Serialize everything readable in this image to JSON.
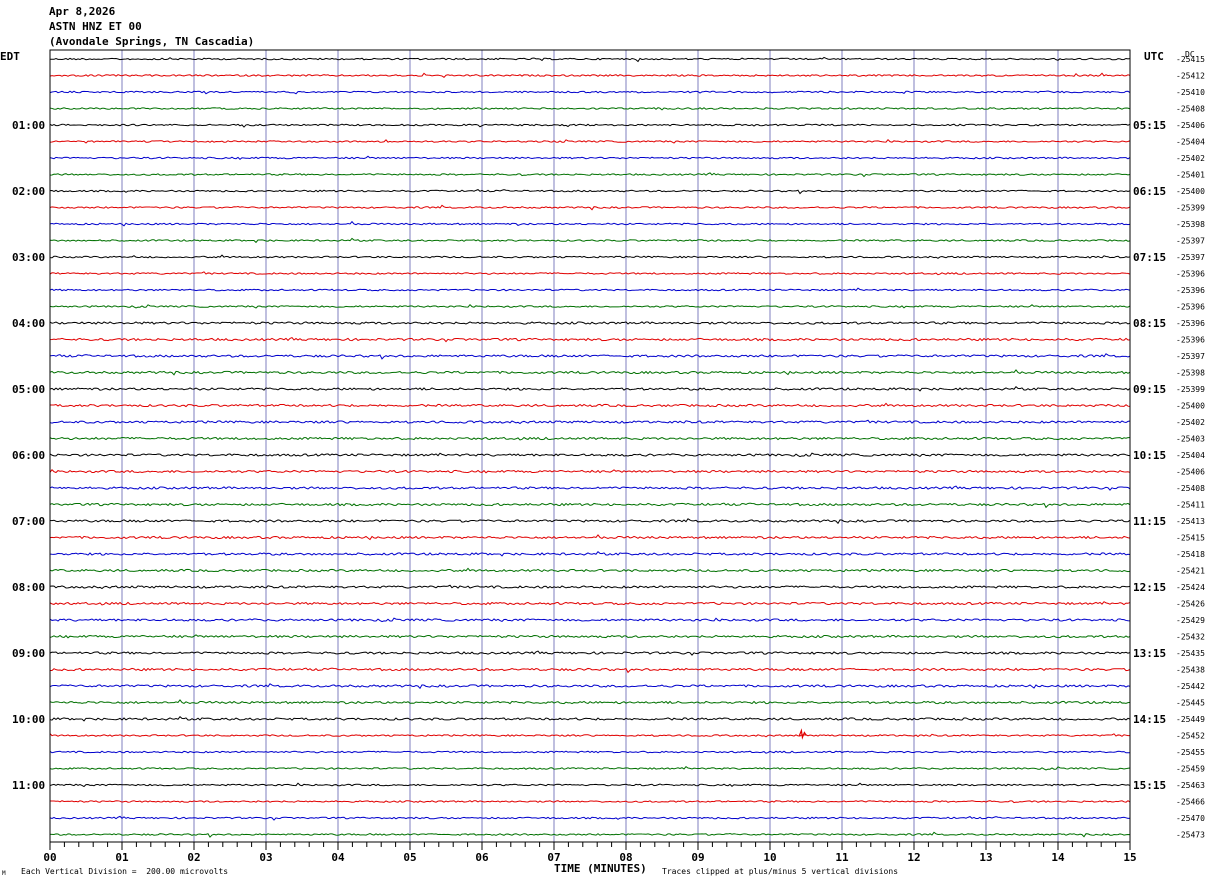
{
  "header": {
    "date": "Apr 8,2026",
    "station": "ASTN HNZ ET 00",
    "location": "(Avondale Springs, TN Cascadia)"
  },
  "left_timezone": "EDT",
  "right_timezone": "UTC",
  "dc_label": "DC",
  "footer": {
    "scale": "Each Vertical Division =  200.00 microvolts",
    "clip": "Traces clipped at plus/minus 5 vertical divisions",
    "mark": "M"
  },
  "colors": {
    "trace_cycle": [
      "#000000",
      "#e00000",
      "#0000cc",
      "#007000"
    ],
    "grid": "#7f7fbf",
    "frame": "#000000"
  },
  "chart_data": {
    "type": "line",
    "title": "ASTN HNZ ET 00",
    "xlabel": "TIME (MINUTES)",
    "ylabel": "",
    "xlim": [
      0,
      15
    ],
    "x_tick_labels": [
      "00",
      "01",
      "02",
      "03",
      "04",
      "05",
      "06",
      "07",
      "08",
      "09",
      "10",
      "11",
      "12",
      "13",
      "14",
      "15"
    ],
    "trace_count": 48,
    "minutes_per_trace": 15,
    "left_time_labels": [
      "01:00",
      "02:00",
      "03:00",
      "04:00",
      "05:00",
      "06:00",
      "07:00",
      "08:00",
      "09:00",
      "10:00",
      "11:00"
    ],
    "right_time_labels": [
      "05:15",
      "06:15",
      "07:15",
      "08:15",
      "09:15",
      "10:15",
      "11:15",
      "12:15",
      "13:15",
      "14:15",
      "15:15"
    ],
    "dc_offsets": [
      "-25415",
      "-25412",
      "-25410",
      "-25408",
      "-25406",
      "-25404",
      "-25402",
      "-25401",
      "-25400",
      "-25399",
      "-25398",
      "-25397",
      "-25397",
      "-25396",
      "-25396",
      "-25396",
      "-25396",
      "-25396",
      "-25397",
      "-25398",
      "-25399",
      "-25400",
      "-25402",
      "-25403",
      "-25404",
      "-25406",
      "-25408",
      "-25411",
      "-25413",
      "-25415",
      "-25418",
      "-25421",
      "-25424",
      "-25426",
      "-25429",
      "-25432",
      "-25435",
      "-25438",
      "-25442",
      "-25445",
      "-25449",
      "-25452",
      "-25455",
      "-25459",
      "-25463",
      "-25466",
      "-25470",
      "-25473"
    ],
    "events": [
      {
        "trace": 41,
        "minute": 10.45,
        "amplitude": "small spike"
      }
    ]
  }
}
